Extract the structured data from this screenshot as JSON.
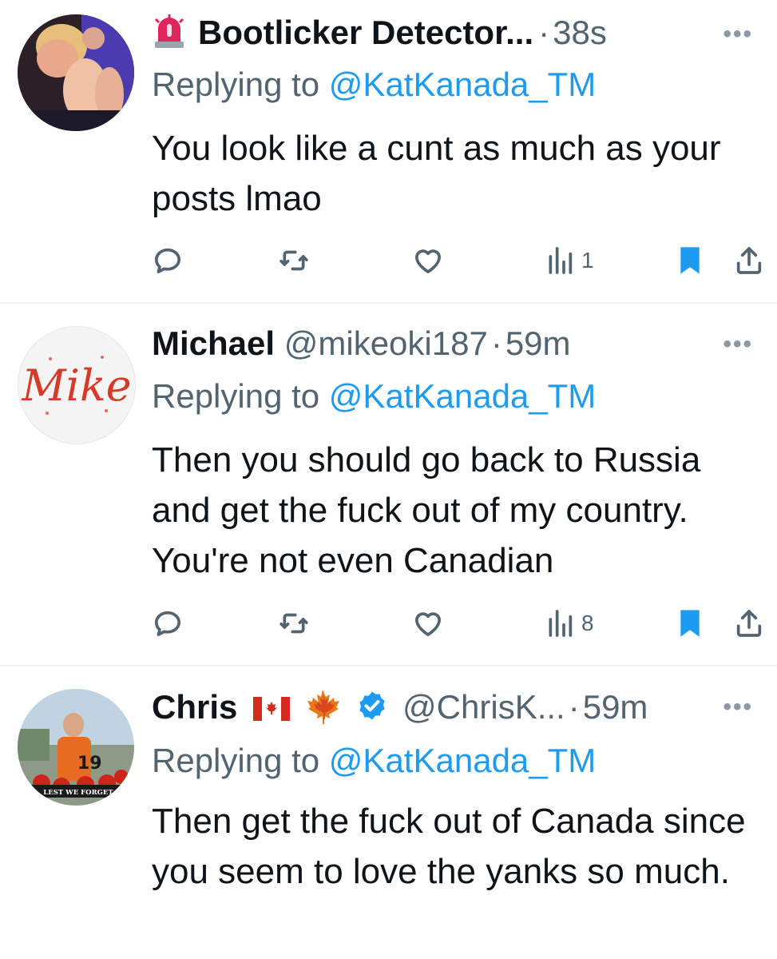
{
  "tweets": [
    {
      "name": "Bootlicker Detector...",
      "handle": "",
      "time": "38s",
      "sep": "·",
      "replying_prefix": "Replying to",
      "replying_to": "@KatKanada_TM",
      "text": "You look like a cunt as much as your posts lmao",
      "views": "1",
      "bookmarked": true
    },
    {
      "name": "Michael",
      "handle": "@mikeoki187",
      "time": "59m",
      "sep": "·",
      "replying_prefix": "Replying to",
      "replying_to": "@KatKanada_TM",
      "text": "Then you should go back to Russia and get the fuck out of my country. You're not even Canadian",
      "views": "8",
      "bookmarked": true,
      "avatar_text": "Mike"
    },
    {
      "name": "Chris",
      "handle": "@ChrisK...",
      "time": "59m",
      "sep": "·",
      "replying_prefix": "Replying to",
      "replying_to": "@KatKanada_TM",
      "text": "Then get the fuck out of Canada since you seem to love the yanks so much.",
      "avatar_text": "LEST WE FORGET",
      "jersey_number": "19",
      "verified": true
    }
  ],
  "more_label": "•••",
  "colors": {
    "accent": "#1d9bf0",
    "muted": "#536471",
    "text": "#0f1419",
    "divider": "#eff3f4"
  },
  "icons": [
    "siren-icon",
    "reply-icon",
    "retweet-icon",
    "like-icon",
    "views-icon",
    "bookmark-icon",
    "share-icon",
    "canada-flag-icon",
    "maple-leaf-icon",
    "verified-badge-icon",
    "more-icon"
  ]
}
